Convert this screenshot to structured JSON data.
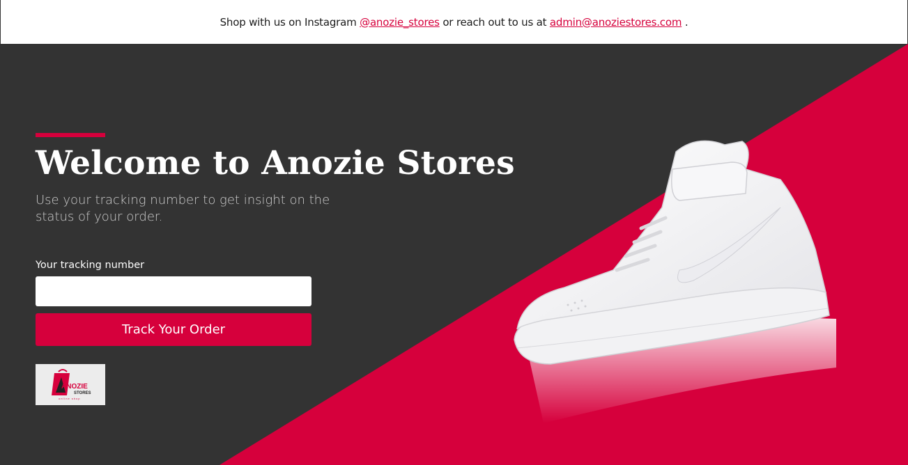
{
  "topbar": {
    "text_before": "Shop with us on Instagram",
    "instagram_handle": "@anozie_stores",
    "text_middle": "or reach out to us at",
    "email": "admin@anoziestores.com",
    "text_after": "."
  },
  "hero": {
    "title": "Welcome to Anozie Stores",
    "subtitle": "Use your tracking number to get insight on the status of your order.",
    "form": {
      "label": "Your tracking number",
      "input_value": "",
      "input_placeholder": "",
      "button_label": "Track Your Order"
    },
    "logo": {
      "brand_text": "ANOZIE",
      "sub_text": "STORES",
      "tagline": "online shop"
    },
    "image": "white-high-top-sneaker"
  },
  "colors": {
    "accent": "#d6003c",
    "dark_background": "#333333",
    "text_light": "#ffffff"
  }
}
